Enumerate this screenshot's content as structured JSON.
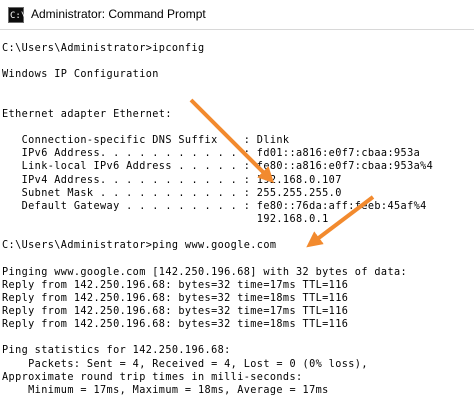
{
  "window": {
    "icon_text": "C:\\",
    "title": "Administrator: Command Prompt"
  },
  "console": {
    "lines": [
      "C:\\Users\\Administrator>ipconfig",
      "",
      "Windows IP Configuration",
      "",
      "",
      "Ethernet adapter Ethernet:",
      "",
      "   Connection-specific DNS Suffix  . : Dlink",
      "   IPv6 Address. . . . . . . . . . . : fd01::a816:e0f7:cbaa:953a",
      "   Link-local IPv6 Address . . . . . : fe80::a816:e0f7:cbaa:953a%4",
      "   IPv4 Address. . . . . . . . . . . : 192.168.0.107",
      "   Subnet Mask . . . . . . . . . . . : 255.255.255.0",
      "   Default Gateway . . . . . . . . . : fe80::76da:aff:feeb:45af%4",
      "                                       192.168.0.1",
      "",
      "C:\\Users\\Administrator>ping www.google.com",
      "",
      "Pinging www.google.com [142.250.196.68] with 32 bytes of data:",
      "Reply from 142.250.196.68: bytes=32 time=17ms TTL=116",
      "Reply from 142.250.196.68: bytes=32 time=18ms TTL=116",
      "Reply from 142.250.196.68: bytes=32 time=17ms TTL=116",
      "Reply from 142.250.196.68: bytes=32 time=18ms TTL=116",
      "",
      "Ping statistics for 142.250.196.68:",
      "    Packets: Sent = 4, Received = 4, Lost = 0 (0% loss),",
      "Approximate round trip times in milli-seconds:",
      "    Minimum = 17ms, Maximum = 18ms, Average = 17ms"
    ]
  },
  "colors": {
    "console_background": "#ffffff",
    "console_text": "#000000",
    "arrow": "#f28a2e"
  },
  "annotations": [
    {
      "name": "arrow-to-ipv4-address",
      "icon": "arrow-icon"
    },
    {
      "name": "arrow-to-default-gateway",
      "icon": "arrow-icon"
    }
  ]
}
